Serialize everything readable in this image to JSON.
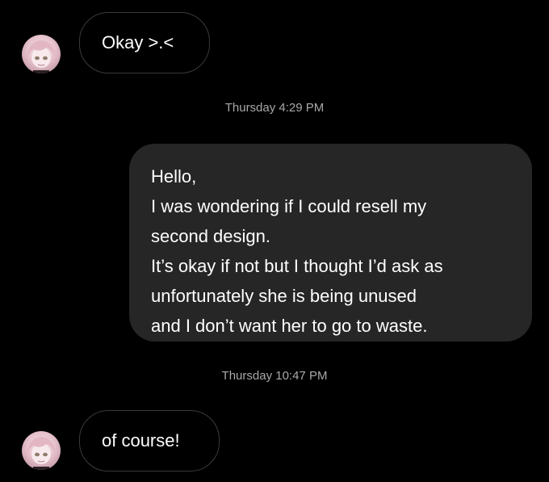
{
  "messages": [
    {
      "sender": "other",
      "text": "Okay >.<"
    },
    {
      "timestamp": "Thursday 4:29 PM"
    },
    {
      "sender": "me",
      "lines": [
        "Hello,",
        "I was wondering if I could resell my",
        "second design.",
        "It’s okay if not but I thought I’d ask as",
        "unfortunately she is being unused",
        "and I don’t want her to go to waste."
      ]
    },
    {
      "timestamp": "Thursday 10:47 PM"
    },
    {
      "sender": "other",
      "text": "of course!"
    }
  ],
  "avatar": {
    "icon": "anime-avatar-icon",
    "colors": {
      "hair": "#e7c3cd",
      "eyes": "#8d7a6a"
    }
  },
  "theme": {
    "background": "#000000",
    "bubble_out": "#262626",
    "bubble_in_border": "#3a3a3a",
    "timestamp": "#a8a8a8"
  }
}
